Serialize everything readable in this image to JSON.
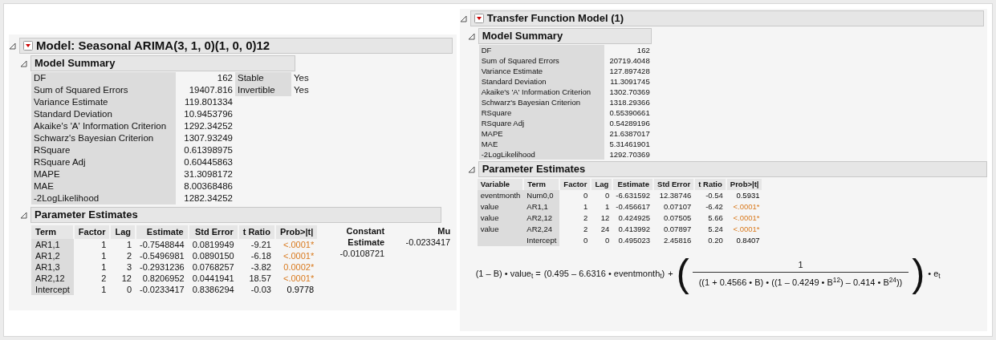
{
  "left": {
    "title": "Model: Seasonal ARIMA(3, 1, 0)(1, 0, 0)12",
    "summary": {
      "title": "Model Summary",
      "rows": [
        {
          "label": "DF",
          "value": "162"
        },
        {
          "label": "Sum of Squared Errors",
          "value": "19407.816"
        },
        {
          "label": "Variance Estimate",
          "value": "119.801334"
        },
        {
          "label": "Standard Deviation",
          "value": "10.9453796"
        },
        {
          "label": "Akaike's 'A' Information Criterion",
          "value": "1292.34252"
        },
        {
          "label": "Schwarz's Bayesian Criterion",
          "value": "1307.93249"
        },
        {
          "label": "RSquare",
          "value": "0.61398975"
        },
        {
          "label": "RSquare Adj",
          "value": "0.60445863"
        },
        {
          "label": "MAPE",
          "value": "31.3098172"
        },
        {
          "label": "MAE",
          "value": "8.00368486"
        },
        {
          "label": "-2LogLikelihood",
          "value": "1282.34252"
        }
      ],
      "checks": [
        {
          "label": "Stable",
          "value": "Yes"
        },
        {
          "label": "Invertible",
          "value": "Yes"
        }
      ]
    },
    "params": {
      "title": "Parameter Estimates",
      "columns": [
        "Term",
        "Factor",
        "Lag",
        "Estimate",
        "Std Error",
        "t Ratio",
        "Prob>|t|"
      ],
      "rows": [
        {
          "cells": [
            "AR1,1",
            "1",
            "1",
            "-0.7548844",
            "0.0819949",
            "-9.21",
            "<.0001*"
          ],
          "significant": true
        },
        {
          "cells": [
            "AR1,2",
            "1",
            "2",
            "-0.5496981",
            "0.0890150",
            "-6.18",
            "<.0001*"
          ],
          "significant": true
        },
        {
          "cells": [
            "AR1,3",
            "1",
            "3",
            "-0.2931236",
            "0.0768257",
            "-3.82",
            "0.0002*"
          ],
          "significant": true
        },
        {
          "cells": [
            "AR2,12",
            "2",
            "12",
            "0.8206952",
            "0.0441941",
            "18.57",
            "<.0001*"
          ],
          "significant": true
        },
        {
          "cells": [
            "Intercept",
            "1",
            "0",
            "-0.0233417",
            "0.8386294",
            "-0.03",
            "0.9778"
          ],
          "significant": false
        }
      ],
      "constant": {
        "label": "Constant Estimate",
        "value": "-0.0108721"
      },
      "mu": {
        "label": "Mu",
        "value": "-0.0233417"
      }
    }
  },
  "right": {
    "title": "Transfer Function Model (1)",
    "summary": {
      "title": "Model Summary",
      "rows": [
        {
          "label": "DF",
          "value": "162"
        },
        {
          "label": "Sum of Squared Errors",
          "value": "20719.4048"
        },
        {
          "label": "Variance Estimate",
          "value": "127.897428"
        },
        {
          "label": "Standard Deviation",
          "value": "11.3091745"
        },
        {
          "label": "Akaike's 'A' Information Criterion",
          "value": "1302.70369"
        },
        {
          "label": "Schwarz's Bayesian Criterion",
          "value": "1318.29366"
        },
        {
          "label": "RSquare",
          "value": "0.55390661"
        },
        {
          "label": "RSquare Adj",
          "value": "0.54289196"
        },
        {
          "label": "MAPE",
          "value": "21.6387017"
        },
        {
          "label": "MAE",
          "value": "5.31461901"
        },
        {
          "label": "-2LogLikelihood",
          "value": "1292.70369"
        }
      ]
    },
    "params": {
      "title": "Parameter Estimates",
      "columns": [
        "Variable",
        "Term",
        "Factor",
        "Lag",
        "Estimate",
        "Std Error",
        "t Ratio",
        "Prob>|t|"
      ],
      "rows": [
        {
          "cells": [
            "eventmonth",
            "Num0,0",
            "0",
            "0",
            "-6.631592",
            "12.38746",
            "-0.54",
            "0.5931"
          ],
          "significant": false
        },
        {
          "cells": [
            "value",
            "AR1,1",
            "1",
            "1",
            "-0.456617",
            "0.07107",
            "-6.42",
            "<.0001*"
          ],
          "significant": true
        },
        {
          "cells": [
            "value",
            "AR2,12",
            "2",
            "12",
            "0.424925",
            "0.07505",
            "5.66",
            "<.0001*"
          ],
          "significant": true
        },
        {
          "cells": [
            "value",
            "AR2,24",
            "2",
            "24",
            "0.413992",
            "0.07897",
            "5.24",
            "<.0001*"
          ],
          "significant": true
        },
        {
          "cells": [
            "",
            "Intercept",
            "0",
            "0",
            "0.495023",
            "2.45816",
            "0.20",
            "0.8407"
          ],
          "significant": false
        }
      ]
    },
    "equation": {
      "lhs": "(1 – B) • value$_{t}$ =",
      "term": "(0.495 – 6.6316 • eventmonth$_{t}$)",
      "plus": "+",
      "open": "(",
      "numerator": "1",
      "denominator": "((1 + 0.4566 • B) • ((1 – 0.4249 • B$^{12}$) – 0.414 • B$^{24}$))",
      "close": ")",
      "tail": "• e$_{t}$"
    }
  }
}
